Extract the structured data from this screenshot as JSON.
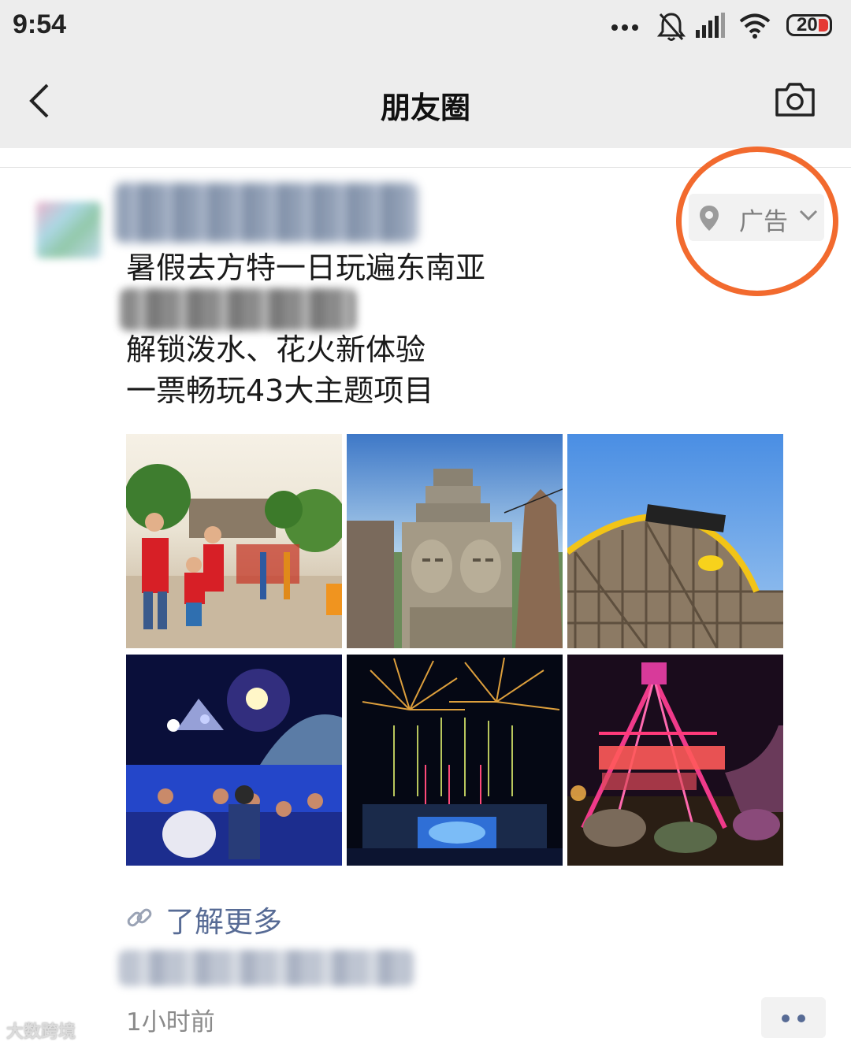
{
  "status_bar": {
    "time": "9:54",
    "battery": "20"
  },
  "nav": {
    "title": "朋友圈"
  },
  "post": {
    "ad_label": "广告",
    "lines": [
      "暑假去方特一日玩遍东南亚",
      "",
      "解锁泼水、花火新体验",
      "一票畅玩43大主题项目"
    ],
    "images": [
      "parade-family",
      "angkor-faces",
      "roller-coaster",
      "water-night-show",
      "fireworks",
      "viking-ride"
    ],
    "link_label": "了解更多",
    "time_ago": "1小时前"
  },
  "watermark": "大数跨境",
  "colors": {
    "accent_link": "#576b95",
    "highlight_ring": "#f26a2e",
    "nav_bg": "#ededed"
  }
}
